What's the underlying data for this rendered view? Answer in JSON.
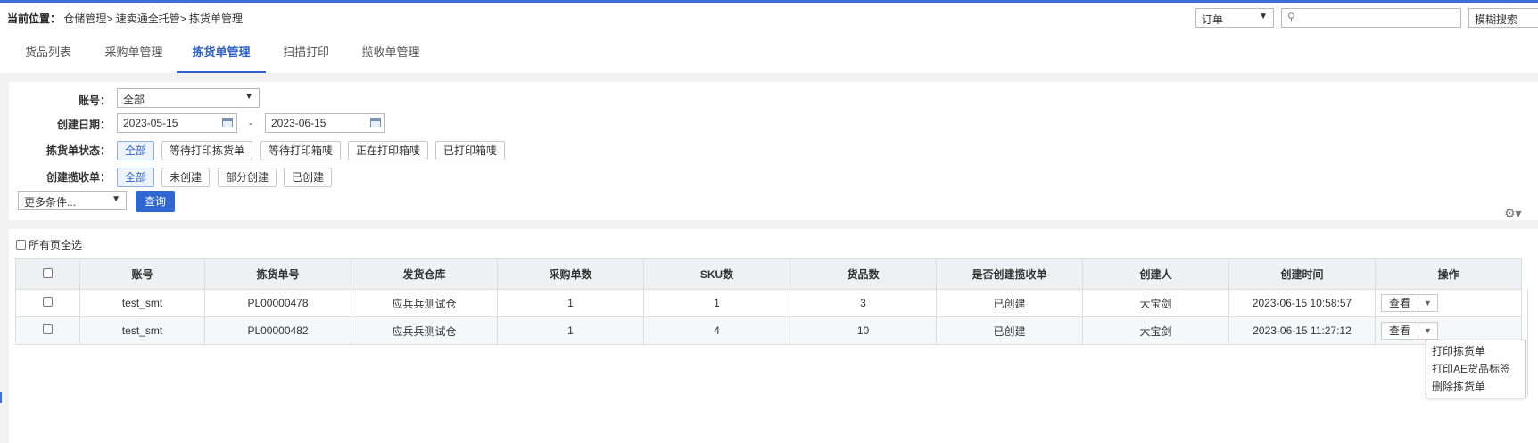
{
  "breadcrumb": {
    "label": "当前位置：",
    "path": "仓储管理> 速卖通全托管> 拣货单管理"
  },
  "search": {
    "type_value": "订单",
    "placeholder": "",
    "fuzzy_label": "模糊搜索"
  },
  "tabs": [
    {
      "label": "货品列表"
    },
    {
      "label": "采购单管理"
    },
    {
      "label": "拣货单管理",
      "active": true
    },
    {
      "label": "扫描打印"
    },
    {
      "label": "揽收单管理"
    }
  ],
  "filters": {
    "account_label": "账号：",
    "account_value": "全部",
    "date_label": "创建日期：",
    "date_from": "2023-05-15",
    "date_sep": "-",
    "date_to": "2023-06-15",
    "status_label": "拣货单状态：",
    "status_options": [
      "全部",
      "等待打印拣货单",
      "等待打印箱唛",
      "正在打印箱唛",
      "已打印箱唛"
    ],
    "collect_label": "创建揽收单：",
    "collect_options": [
      "全部",
      "未创建",
      "部分创建",
      "已创建"
    ],
    "more_label": "更多条件...",
    "query_label": "查询"
  },
  "select_all_pages": "所有页全选",
  "table": {
    "columns": [
      "账号",
      "拣货单号",
      "发货仓库",
      "采购单数",
      "SKU数",
      "货品数",
      "是否创建揽收单",
      "创建人",
      "创建时间",
      "操作"
    ],
    "rows": [
      {
        "account": "test_smt",
        "pick_no": "PL00000478",
        "warehouse": "应兵兵测试仓",
        "po_count": "1",
        "sku_count": "1",
        "goods_count": "3",
        "collect_created": "已创建",
        "creator": "大宝剑",
        "created_at": "2023-06-15 10:58:57",
        "action": "查看"
      },
      {
        "account": "test_smt",
        "pick_no": "PL00000482",
        "warehouse": "应兵兵测试仓",
        "po_count": "1",
        "sku_count": "4",
        "goods_count": "10",
        "collect_created": "已创建",
        "creator": "大宝剑",
        "created_at": "2023-06-15 11:27:12",
        "action": "查看"
      }
    ]
  },
  "action_menu": [
    "打印拣货单",
    "打印AE货品标签",
    "删除拣货单"
  ],
  "colors": {
    "accent": "#2f5fc8",
    "topline": "#3d6fd6"
  },
  "icons": {
    "search": "magnifier-icon",
    "calendar": "calendar-icon",
    "settings": "gear-icon"
  }
}
